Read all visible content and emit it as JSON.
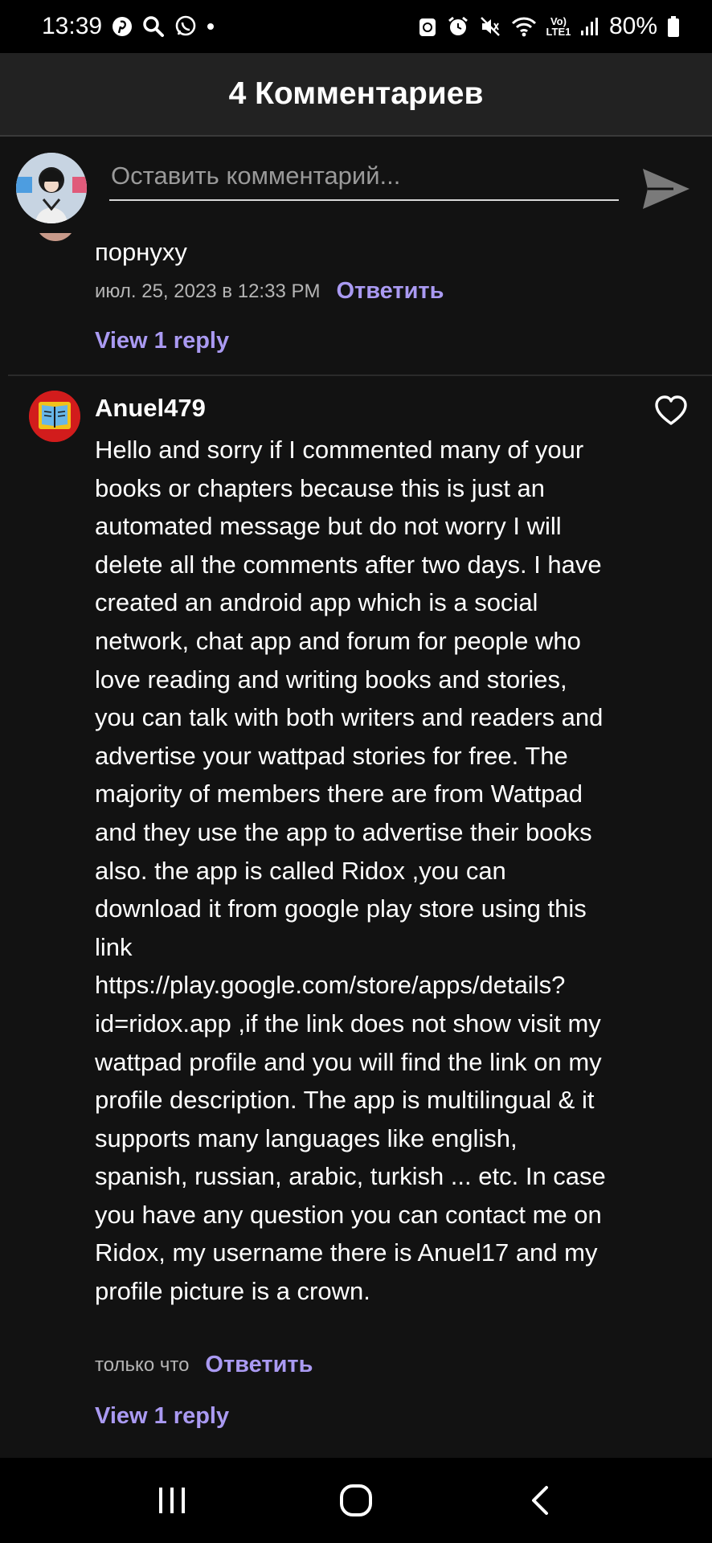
{
  "status_bar": {
    "time": "13:39",
    "network": "Vo) LTE1",
    "battery": "80%",
    "left_icons": [
      "pinterest-icon",
      "search-icon",
      "whatsapp-icon",
      "dot-icon"
    ],
    "right_icons": [
      "recycle-icon",
      "alarm-icon",
      "mute-icon",
      "wifi-icon",
      "signal-icon",
      "battery-icon"
    ]
  },
  "header": {
    "title": "4 Комментариев"
  },
  "input": {
    "placeholder": "Оставить комментарий..."
  },
  "comments": [
    {
      "text": "порнуху",
      "time": "июл. 25, 2023 в 12:33 PM",
      "reply_label": "Ответить",
      "view_replies": "View 1 reply"
    },
    {
      "username": "Anuel479",
      "text": "Hello and sorry if I commented many of your books or chapters because this is just an automated message but do not worry I will delete all the comments after two days. I have created an android app which is a social network, chat app and forum for people who love reading and writing books and stories, you can talk with both writers and readers and advertise your wattpad stories for free. The majority of members there are from Wattpad and they use the app to advertise their books also. the app is called Ridox ,you can download it from google play store using this link https://play.google.com/store/apps/details?id=ridox.app ,if the link does not show visit my wattpad profile and you will find the link on my profile description. The app is multilingual & it supports many languages like english, spanish, russian, arabic, turkish ... etc. In case you have any question you can contact me on Ridox, my username there is Anuel17 and my profile picture is a crown.",
      "time": "только что",
      "reply_label": "Ответить",
      "view_replies": "View 1 reply"
    }
  ],
  "colors": {
    "accent": "#aa9af2",
    "background": "#121212",
    "header_bg": "#222222",
    "meta_text": "#b5b5b5"
  }
}
